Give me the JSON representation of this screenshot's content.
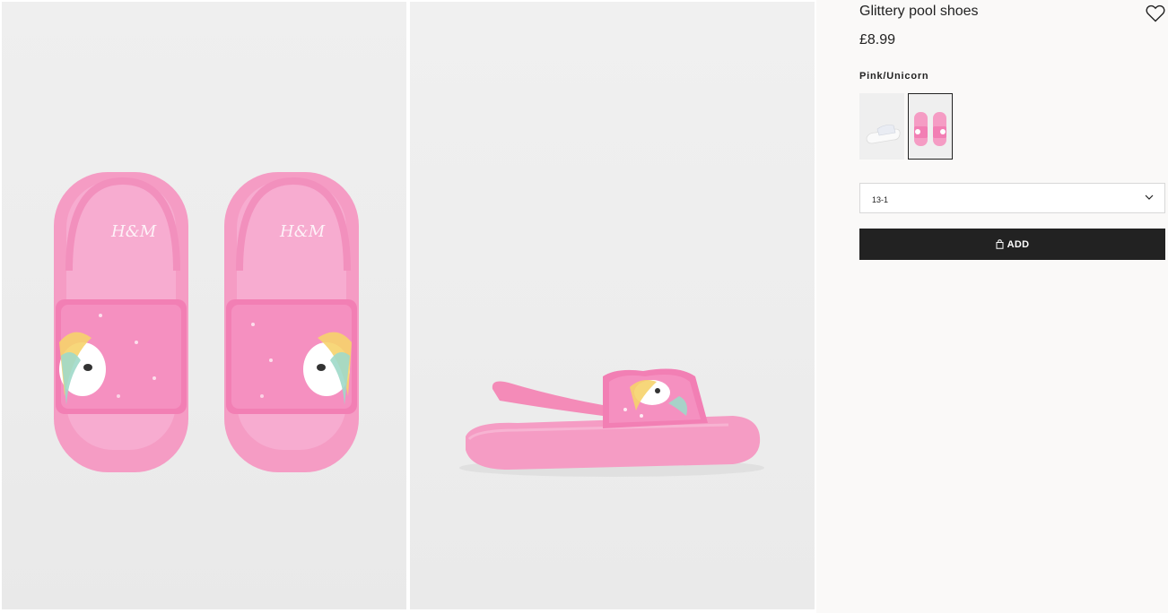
{
  "product": {
    "title": "Glittery pool shoes",
    "price": "£8.99",
    "color_name": "Pink/Unicorn"
  },
  "images": [
    {
      "name": "product-image-top-view",
      "icon": "pink-slides-pair"
    },
    {
      "name": "product-image-side-view",
      "icon": "pink-slide-side"
    }
  ],
  "swatches": [
    {
      "name": "white-variant",
      "selected": false
    },
    {
      "name": "pink-unicorn-variant",
      "selected": true
    }
  ],
  "size_select": {
    "value": "13-1",
    "icon": "chevron-down-icon"
  },
  "add_button": {
    "label": "ADD",
    "icon": "shopping-bag-icon"
  },
  "colors": {
    "accent": "#222222",
    "shoe_pink": "#f48bb8",
    "background": "#faf9f8"
  }
}
